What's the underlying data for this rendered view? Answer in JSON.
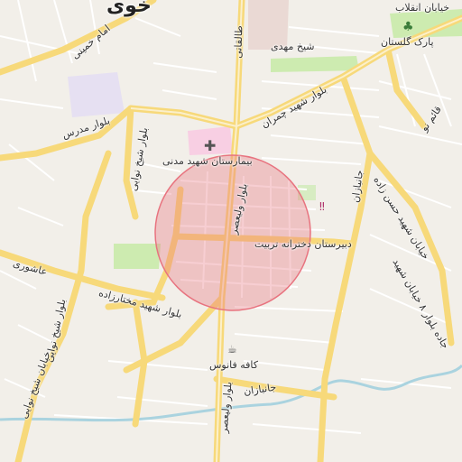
{
  "map": {
    "city_label": "خوی",
    "streets": [
      {
        "key": "taleghani",
        "text": "طالقانی"
      },
      {
        "key": "emam_khomeini",
        "text": "امام خمینی"
      },
      {
        "key": "modares",
        "text": "بلوار مدرس"
      },
      {
        "key": "sheikh_navaei_1",
        "text": "بلوار شیخ نوایی"
      },
      {
        "key": "sheikh_navaei_2",
        "text": "بلوار شیخ نوایی"
      },
      {
        "key": "sheikh_navaei_3",
        "text": "خیابان شیخ نوایی"
      },
      {
        "key": "ashouri",
        "text": "عاشوری"
      },
      {
        "key": "mokhtarzadeh",
        "text": "بلوار شهید مختارزاده"
      },
      {
        "key": "valiasr_n",
        "text": "بلوار ولیعصر"
      },
      {
        "key": "valiasr_s",
        "text": "بلوار ولیعصر"
      },
      {
        "key": "chamran",
        "text": "بلوار شهید چمران"
      },
      {
        "key": "sheikh_mahdi",
        "text": "شیخ مهدی"
      },
      {
        "key": "enghelab",
        "text": "خیابان انقلاب"
      },
      {
        "key": "jahan_bani",
        "text": "جانبازان"
      },
      {
        "key": "janbazan_s",
        "text": "جانبازان"
      },
      {
        "key": "ghaem",
        "text": "قائم نو"
      },
      {
        "key": "hasan",
        "text": "خیابان شهید حسن زاده"
      },
      {
        "key": "ahmad",
        "text": "جاده بلوار ۸ خیابان شهید"
      }
    ],
    "pois": [
      {
        "key": "hospital",
        "text": "بیمارستان شهید مدنی",
        "icon": "hospital-cross-icon"
      },
      {
        "key": "school",
        "text": "دبیرستان دخترانه تربیت",
        "icon": "school-icon"
      },
      {
        "key": "cafe",
        "text": "کافه فانوس",
        "icon": "cafe-icon"
      },
      {
        "key": "park",
        "text": "پارک گلستان",
        "icon": "tree-icon"
      }
    ],
    "highlight_circle_color": "#e8737f",
    "road_color": "#f7d97a",
    "water_color": "#aad3df",
    "land_color": "#f2efe9"
  }
}
